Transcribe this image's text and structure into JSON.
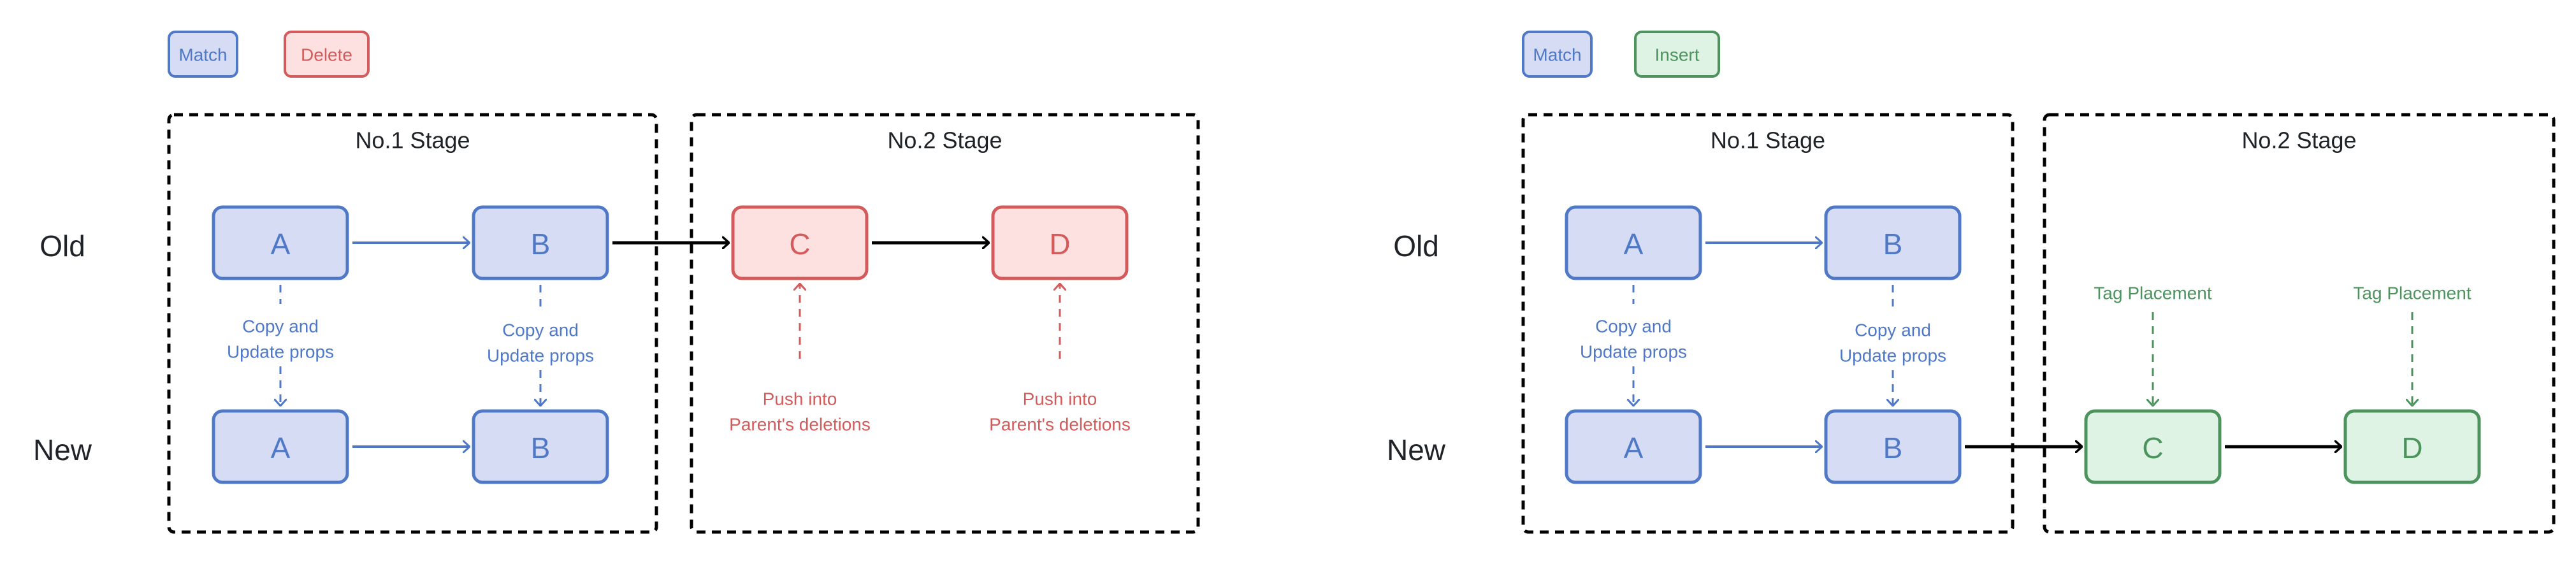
{
  "colors": {
    "match_stroke": "#4f78c7",
    "match_fill": "#d6dcf4",
    "delete_stroke": "#d45b5b",
    "delete_fill": "#fde1e1",
    "insert_stroke": "#4c935e",
    "insert_fill": "#dff3e4",
    "ink": "#1f2328",
    "connector": "#000000"
  },
  "panels": [
    {
      "id": "delete",
      "legend": [
        {
          "label": "Match",
          "kind": "match"
        },
        {
          "label": "Delete",
          "kind": "delete"
        }
      ],
      "row_labels": {
        "old": "Old",
        "new": "New"
      },
      "stages": [
        {
          "title": "No.1 Stage"
        },
        {
          "title": "No.2 Stage"
        }
      ],
      "nodes": [
        {
          "id": "old-A",
          "label": "A",
          "kind": "match"
        },
        {
          "id": "old-B",
          "label": "B",
          "kind": "match"
        },
        {
          "id": "old-C",
          "label": "C",
          "kind": "delete"
        },
        {
          "id": "old-D",
          "label": "D",
          "kind": "delete"
        },
        {
          "id": "new-A",
          "label": "A",
          "kind": "match"
        },
        {
          "id": "new-B",
          "label": "B",
          "kind": "match"
        }
      ],
      "annotations": [
        {
          "lines": [
            "Copy and",
            "Update props"
          ],
          "kind": "match"
        },
        {
          "lines": [
            "Copy and",
            "Update props"
          ],
          "kind": "match"
        },
        {
          "lines": [
            "Push into",
            "Parent's deletions"
          ],
          "kind": "delete"
        },
        {
          "lines": [
            "Push into",
            "Parent's deletions"
          ],
          "kind": "delete"
        }
      ]
    },
    {
      "id": "insert",
      "legend": [
        {
          "label": "Match",
          "kind": "match"
        },
        {
          "label": "Insert",
          "kind": "insert"
        }
      ],
      "row_labels": {
        "old": "Old",
        "new": "New"
      },
      "stages": [
        {
          "title": "No.1 Stage"
        },
        {
          "title": "No.2 Stage"
        }
      ],
      "nodes": [
        {
          "id": "old-A",
          "label": "A",
          "kind": "match"
        },
        {
          "id": "old-B",
          "label": "B",
          "kind": "match"
        },
        {
          "id": "new-A",
          "label": "A",
          "kind": "match"
        },
        {
          "id": "new-B",
          "label": "B",
          "kind": "match"
        },
        {
          "id": "new-C",
          "label": "C",
          "kind": "insert"
        },
        {
          "id": "new-D",
          "label": "D",
          "kind": "insert"
        }
      ],
      "annotations": [
        {
          "lines": [
            "Copy and",
            "Update props"
          ],
          "kind": "match"
        },
        {
          "lines": [
            "Copy and",
            "Update props"
          ],
          "kind": "match"
        },
        {
          "lines": [
            "Tag Placement"
          ],
          "kind": "insert"
        },
        {
          "lines": [
            "Tag Placement"
          ],
          "kind": "insert"
        }
      ]
    }
  ]
}
